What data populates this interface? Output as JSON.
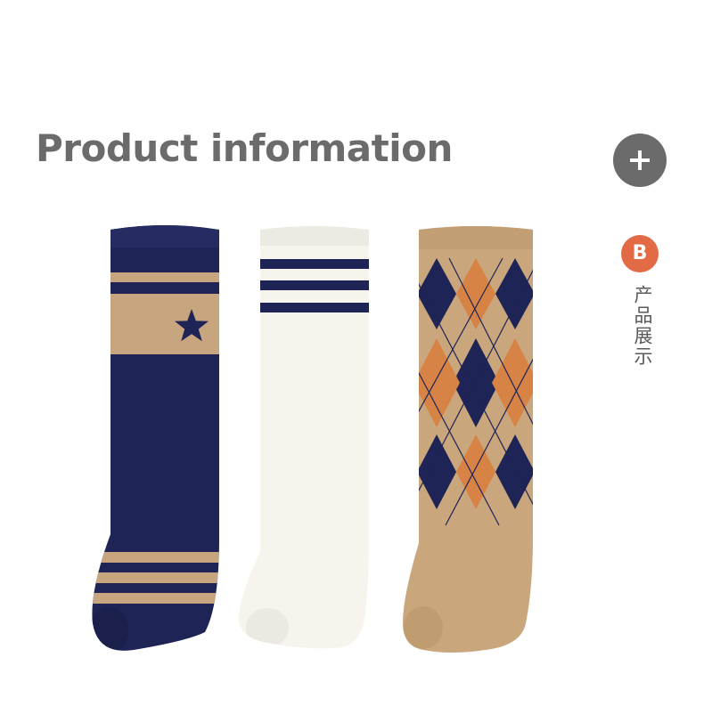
{
  "header": {
    "title": "Product information",
    "add_icon": "plus-icon"
  },
  "section": {
    "badge": "B",
    "label": "产品展示"
  },
  "product": {
    "items": [
      {
        "name": "navy-star-sock",
        "main": "#1f2457",
        "accent": "#c7a57e"
      },
      {
        "name": "white-stripe-sock",
        "main": "#f6f4ed",
        "accent": "#1f2457"
      },
      {
        "name": "argyle-sock",
        "main": "#c9a67c",
        "accent": "#d88346"
      }
    ]
  }
}
